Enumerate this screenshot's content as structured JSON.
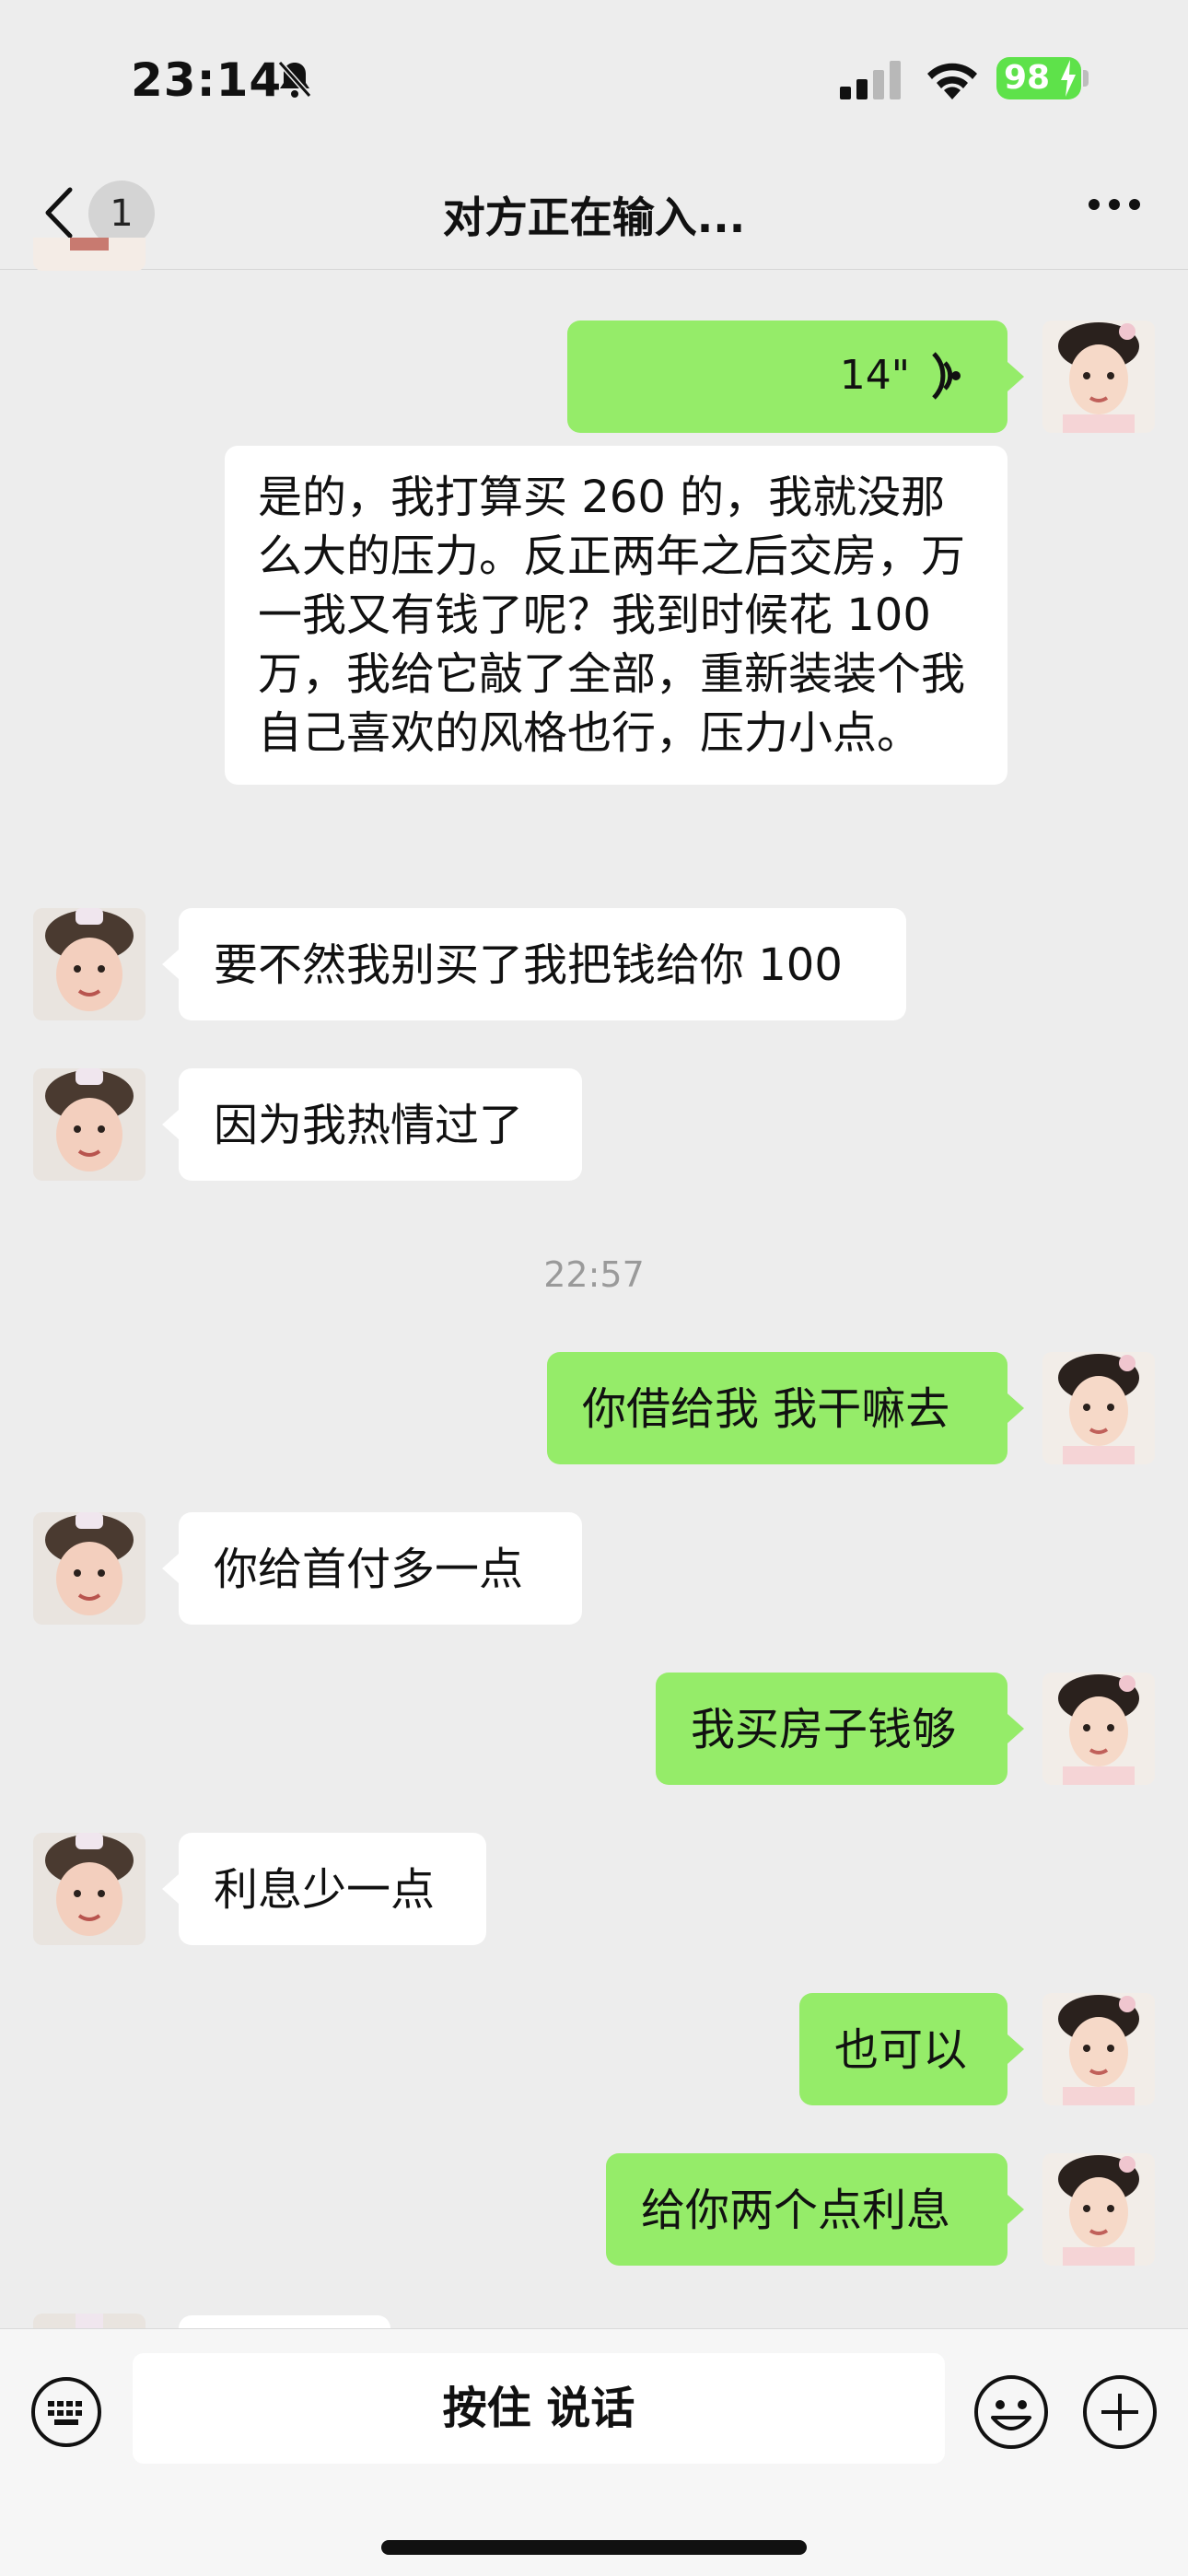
{
  "status": {
    "time": "23:14",
    "battery": "98"
  },
  "nav": {
    "unread": "1",
    "title": "对方正在输入..."
  },
  "voice_msg": {
    "duration": "14\""
  },
  "messages": [
    {
      "side": "left",
      "text": "是的，我打算买 260 的，我就没那么大的压力。反正两年之后交房，万一我又有钱了呢？我到时候花 100 万，我给它敲了全部，重新装装个我自己喜欢的风格也行，压力小点。"
    },
    {
      "side": "left",
      "text": "要不然我别买了我把钱给你 100"
    },
    {
      "side": "left",
      "text": "因为我热情过了"
    },
    {
      "side": "right",
      "text": "你借给我 我干嘛去"
    },
    {
      "side": "left",
      "text": "你给首付多一点"
    },
    {
      "side": "right",
      "text": "我买房子钱够"
    },
    {
      "side": "left",
      "text": "利息少一点"
    },
    {
      "side": "right",
      "text": "也可以"
    },
    {
      "side": "right",
      "text": "给你两个点利息"
    }
  ],
  "timestamp": "22:57",
  "input_bar": {
    "hold_to_talk": "按住 说话"
  },
  "colors": {
    "my_bubble": "#95ec69",
    "their_bubble": "#ffffff",
    "background": "#ededed"
  }
}
